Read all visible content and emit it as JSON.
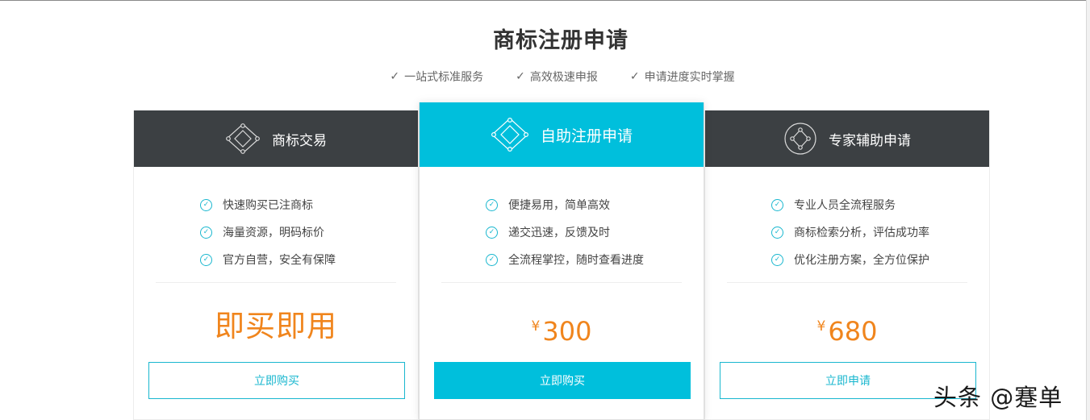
{
  "page": {
    "title": "商标注册申请",
    "features": [
      "一站式标准服务",
      "高效极速申报",
      "申请进度实时掌握"
    ],
    "check_glyph": "✓"
  },
  "colors": {
    "accent": "#00bfdc",
    "dark_header": "#3c4043",
    "price": "#f0851d"
  },
  "cards": [
    {
      "icon": "diamond-network-icon",
      "title": "商标交易",
      "benefits": [
        "快速购买已注商标",
        "海量资源，明码标价",
        "官方自营，安全有保障"
      ],
      "price_text": "即买即用",
      "button": "立即购买"
    },
    {
      "icon": "diamond-network-icon",
      "title": "自助注册申请",
      "benefits": [
        "便捷易用，简单高效",
        "递交迅速，反馈及时",
        "全流程掌控，随时查看进度"
      ],
      "currency": "¥",
      "price": "300",
      "button": "立即购买"
    },
    {
      "icon": "circle-network-icon",
      "title": "专家辅助申请",
      "benefits": [
        "专业人员全流程服务",
        "商标检索分析，评估成功率",
        "优化注册方案，全方位保护"
      ],
      "currency": "¥",
      "price": "680",
      "button": "立即申请"
    }
  ],
  "watermark": "头条 @蹇单"
}
